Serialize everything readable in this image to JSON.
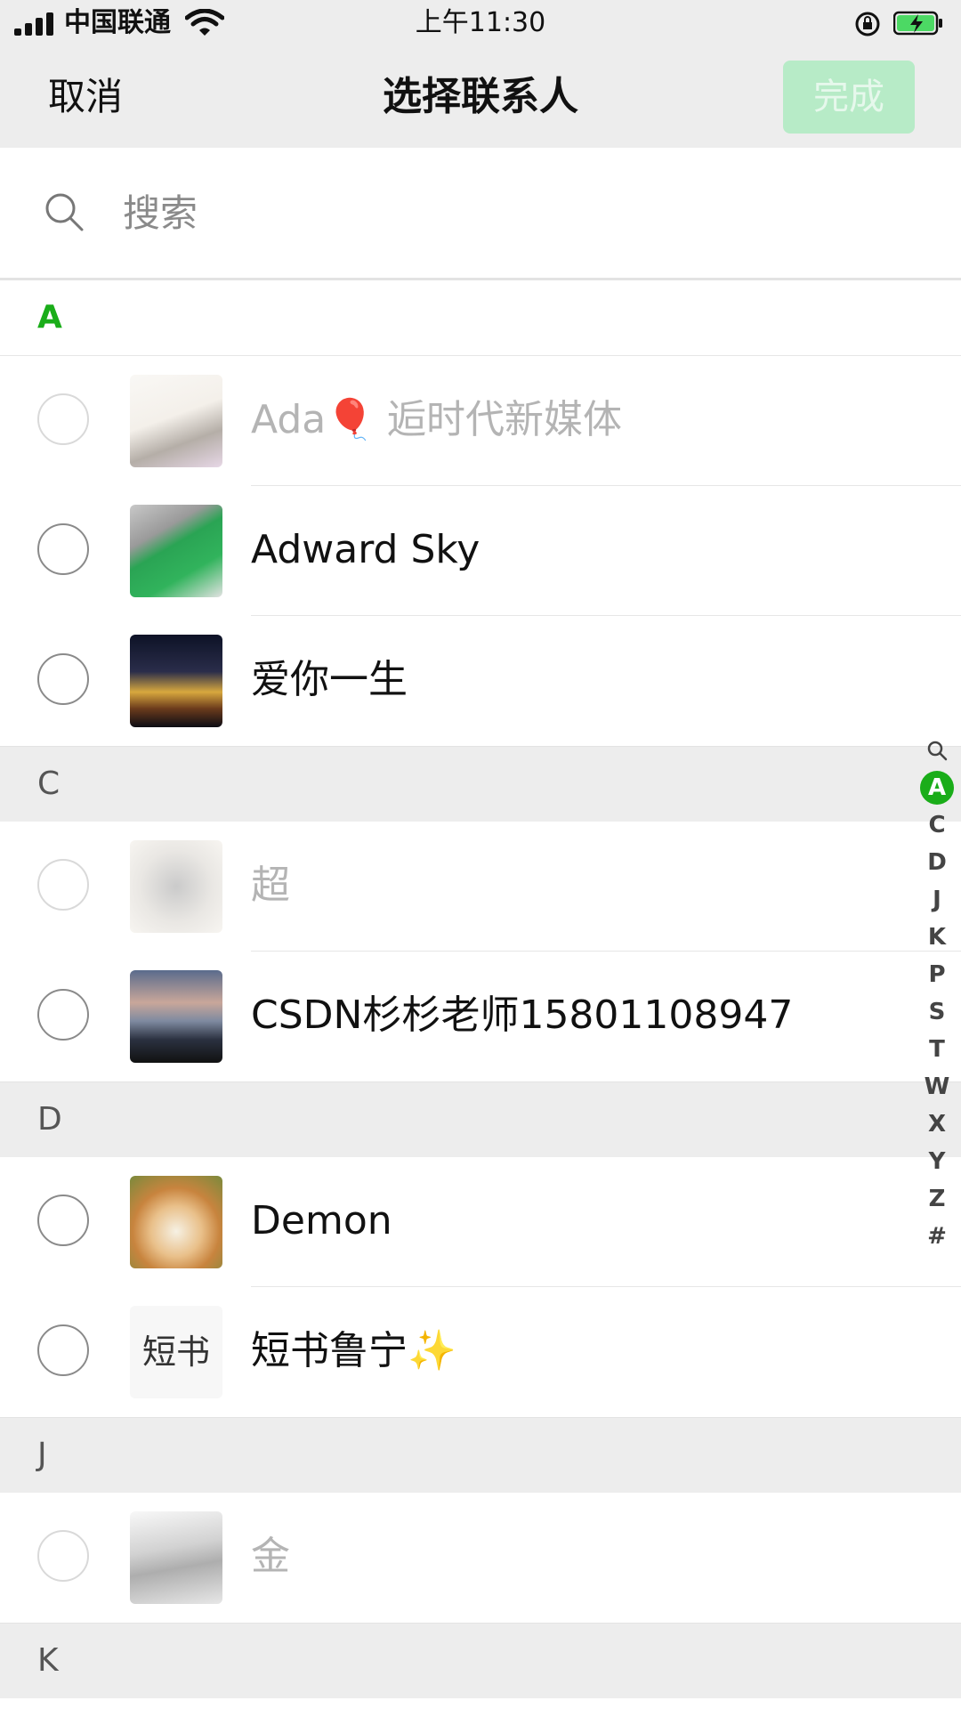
{
  "status_bar": {
    "carrier": "中国联通",
    "time": "上午11:30"
  },
  "nav": {
    "cancel": "取消",
    "title": "选择联系人",
    "done": "完成"
  },
  "search": {
    "placeholder": "搜索"
  },
  "sections": [
    {
      "letter": "A",
      "contacts": [
        {
          "name": "Ada🎈 逅时代新媒体",
          "disabled": true
        },
        {
          "name": "Adward Sky",
          "disabled": false
        },
        {
          "name": "爱你一生",
          "disabled": false
        }
      ]
    },
    {
      "letter": "C",
      "contacts": [
        {
          "name": "超",
          "disabled": true
        },
        {
          "name": "CSDN杉杉老师15801108947",
          "disabled": false
        }
      ]
    },
    {
      "letter": "D",
      "contacts": [
        {
          "name": "Demon",
          "disabled": false
        },
        {
          "name": "短书鲁宁✨",
          "disabled": false
        }
      ]
    },
    {
      "letter": "J",
      "contacts": [
        {
          "name": "金",
          "disabled": true
        }
      ]
    },
    {
      "letter": "K",
      "contacts": []
    }
  ],
  "avatar_labels": {
    "duanshu": "短书"
  },
  "index_letters": [
    "A",
    "C",
    "D",
    "J",
    "K",
    "P",
    "S",
    "T",
    "W",
    "X",
    "Y",
    "Z",
    "#"
  ],
  "index_active": "A",
  "colors": {
    "accent": "#1aad19",
    "done_bg": "#b7ebc7",
    "bar_bg": "#ededed"
  }
}
